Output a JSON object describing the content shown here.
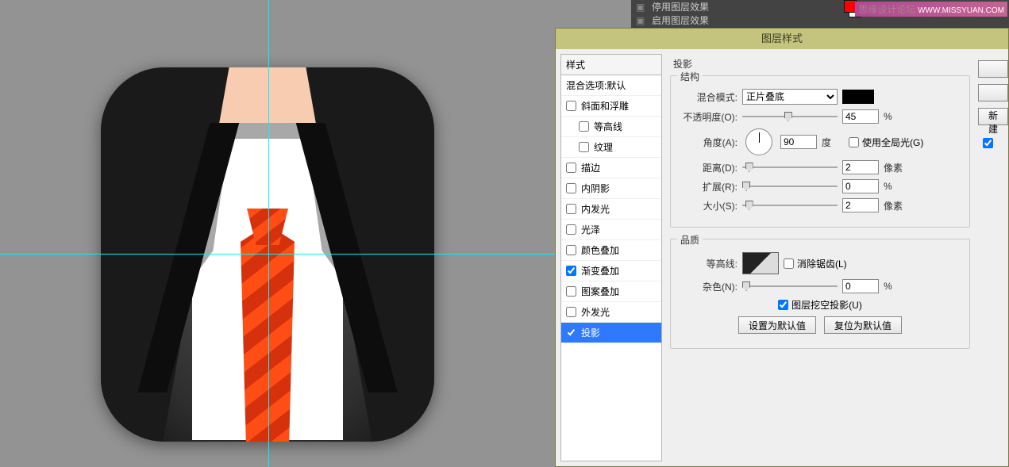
{
  "top_menu": {
    "item1": "停用图层效果",
    "item2": "启用图层效果"
  },
  "watermark": {
    "site": "思缘设计论坛",
    "url": "WWW.MISSYUAN.COM"
  },
  "guides": {
    "v1": 338,
    "h1": 320
  },
  "dialog": {
    "title": "图层样式",
    "styles_header": "样式",
    "blend_default": "混合选项:默认",
    "styles": {
      "bevel": "斜面和浮雕",
      "contour": "等高线",
      "texture": "纹理",
      "stroke": "描边",
      "inner_shadow": "内阴影",
      "inner_glow": "内发光",
      "satin": "光泽",
      "color_overlay": "颜色叠加",
      "gradient_overlay": "渐变叠加",
      "pattern_overlay": "图案叠加",
      "outer_glow": "外发光",
      "drop_shadow": "投影"
    },
    "checked": {
      "gradient_overlay": true,
      "drop_shadow": true
    },
    "panel_title": "投影",
    "structure_legend": "结构",
    "quality_legend": "品质",
    "labels": {
      "blend_mode": "混合模式:",
      "opacity": "不透明度(O):",
      "angle": "角度(A):",
      "degree": "度",
      "use_global": "使用全局光(G)",
      "distance": "距离(D):",
      "spread": "扩展(R):",
      "size": "大小(S):",
      "contour": "等高线:",
      "antialias": "消除锯齿(L)",
      "noise": "杂色(N):",
      "knockout": "图层挖空投影(U)",
      "set_default": "设置为默认值",
      "reset_default": "复位为默认值",
      "percent": "%",
      "px": "像素"
    },
    "values": {
      "blend_mode": "正片叠底",
      "opacity": "45",
      "angle": "90",
      "distance": "2",
      "spread": "0",
      "size": "2",
      "noise": "0",
      "knockout": true,
      "use_global": false
    },
    "right": {
      "new_style_partial": "新建",
      "preview_checked": true
    }
  }
}
